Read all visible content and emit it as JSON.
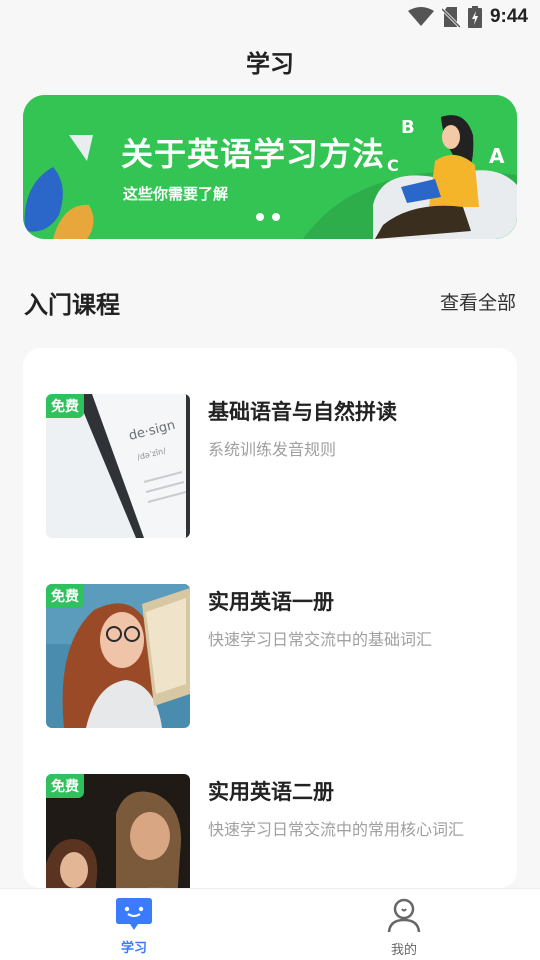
{
  "status": {
    "time": "9:44",
    "icons": [
      "wifi-icon",
      "no-sim-icon",
      "battery-charging-icon"
    ]
  },
  "page": {
    "title": "学习"
  },
  "banner": {
    "title": "关于英语学习方法",
    "subtitle": "这些你需要了解",
    "slides": 2,
    "bg_color": "#33c454"
  },
  "section": {
    "title": "入门课程",
    "more": "查看全部"
  },
  "courses": [
    {
      "badge": "免费",
      "title": "基础语音与自然拼读",
      "desc": "系统训练发音规则",
      "image": "dictionary-design-photo"
    },
    {
      "badge": "免费",
      "title": "实用英语一册",
      "desc": "快速学习日常交流中的基础词汇",
      "image": "woman-reading-book-photo"
    },
    {
      "badge": "免费",
      "title": "实用英语二册",
      "desc": "快速学习日常交流中的常用核心词汇",
      "image": "students-studying-photo"
    }
  ],
  "tabs": [
    {
      "label": "学习",
      "icon": "chat-bubble-icon",
      "active": true
    },
    {
      "label": "我的",
      "icon": "user-profile-icon",
      "active": false
    }
  ],
  "colors": {
    "accent_green": "#2ec15d",
    "tab_active": "#3a7bff",
    "tab_inactive": "#666666"
  }
}
